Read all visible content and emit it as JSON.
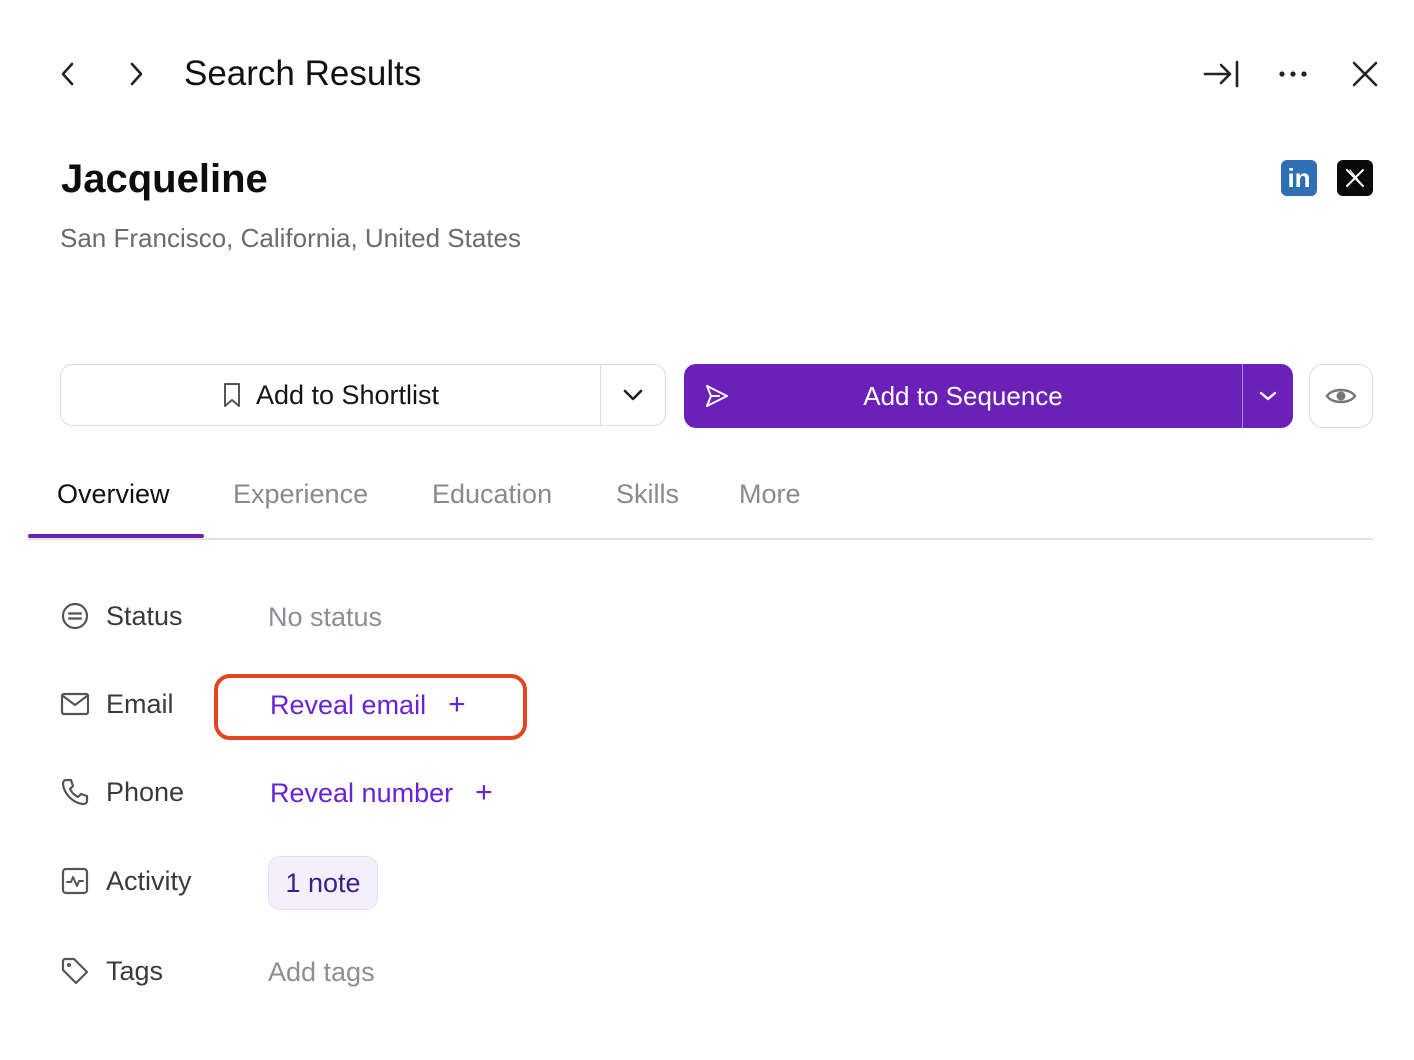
{
  "header": {
    "title": "Search Results",
    "icons": [
      "chevron-left-icon",
      "chevron-right-icon",
      "collapse-panel-icon",
      "more-icon",
      "close-icon"
    ]
  },
  "profile": {
    "name": "Jacqueline",
    "location": "San Francisco, California, United States",
    "social": {
      "linkedin_glyph": "in",
      "x_icon": "x-logo-icon"
    }
  },
  "actions": {
    "shortlist_label": "Add to Shortlist",
    "sequence_label": "Add to Sequence"
  },
  "tabs": [
    {
      "label": "Overview",
      "active": true
    },
    {
      "label": "Experience",
      "active": false
    },
    {
      "label": "Education",
      "active": false
    },
    {
      "label": "Skills",
      "active": false
    },
    {
      "label": "More",
      "active": false
    }
  ],
  "fields": {
    "status": {
      "label": "Status",
      "value": "No status"
    },
    "email": {
      "label": "Email",
      "action": "Reveal email",
      "plus": "+"
    },
    "phone": {
      "label": "Phone",
      "action": "Reveal number",
      "plus": "+"
    },
    "activity": {
      "label": "Activity",
      "value": "1 note"
    },
    "tags": {
      "label": "Tags",
      "value": "Add tags"
    }
  },
  "colors": {
    "accent": "#6b21b8",
    "link": "#6b21d8",
    "highlight": "#e2461e",
    "linkedin": "#2f6fb3"
  }
}
